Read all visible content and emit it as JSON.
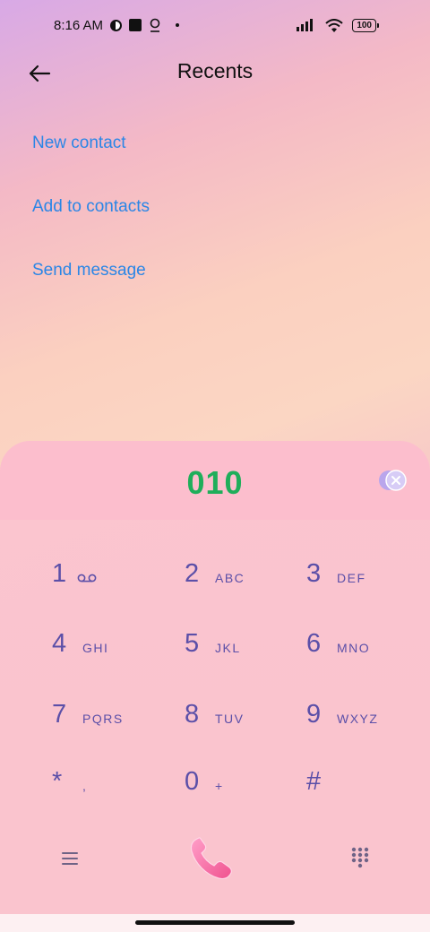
{
  "status_bar": {
    "time": "8:16 AM",
    "battery": "100"
  },
  "header": {
    "title": "Recents",
    "back_icon": "arrow-left-icon"
  },
  "actions": [
    {
      "label": "New contact"
    },
    {
      "label": "Add to contacts"
    },
    {
      "label": "Send message"
    }
  ],
  "dialer": {
    "number": "010",
    "keys": [
      {
        "digit": "1",
        "letters": "",
        "icon": "voicemail-icon"
      },
      {
        "digit": "2",
        "letters": "ABC"
      },
      {
        "digit": "3",
        "letters": "DEF"
      },
      {
        "digit": "4",
        "letters": "GHI"
      },
      {
        "digit": "5",
        "letters": "JKL"
      },
      {
        "digit": "6",
        "letters": "MNO"
      },
      {
        "digit": "7",
        "letters": "PQRS"
      },
      {
        "digit": "8",
        "letters": "TUV"
      },
      {
        "digit": "9",
        "letters": "WXYZ"
      },
      {
        "digit": "*",
        "letters": ","
      },
      {
        "digit": "0",
        "letters": "+"
      },
      {
        "digit": "#",
        "letters": ""
      }
    ]
  },
  "colors": {
    "link": "#2a86e6",
    "number": "#1fae5a",
    "key": "#5b4fa8"
  }
}
